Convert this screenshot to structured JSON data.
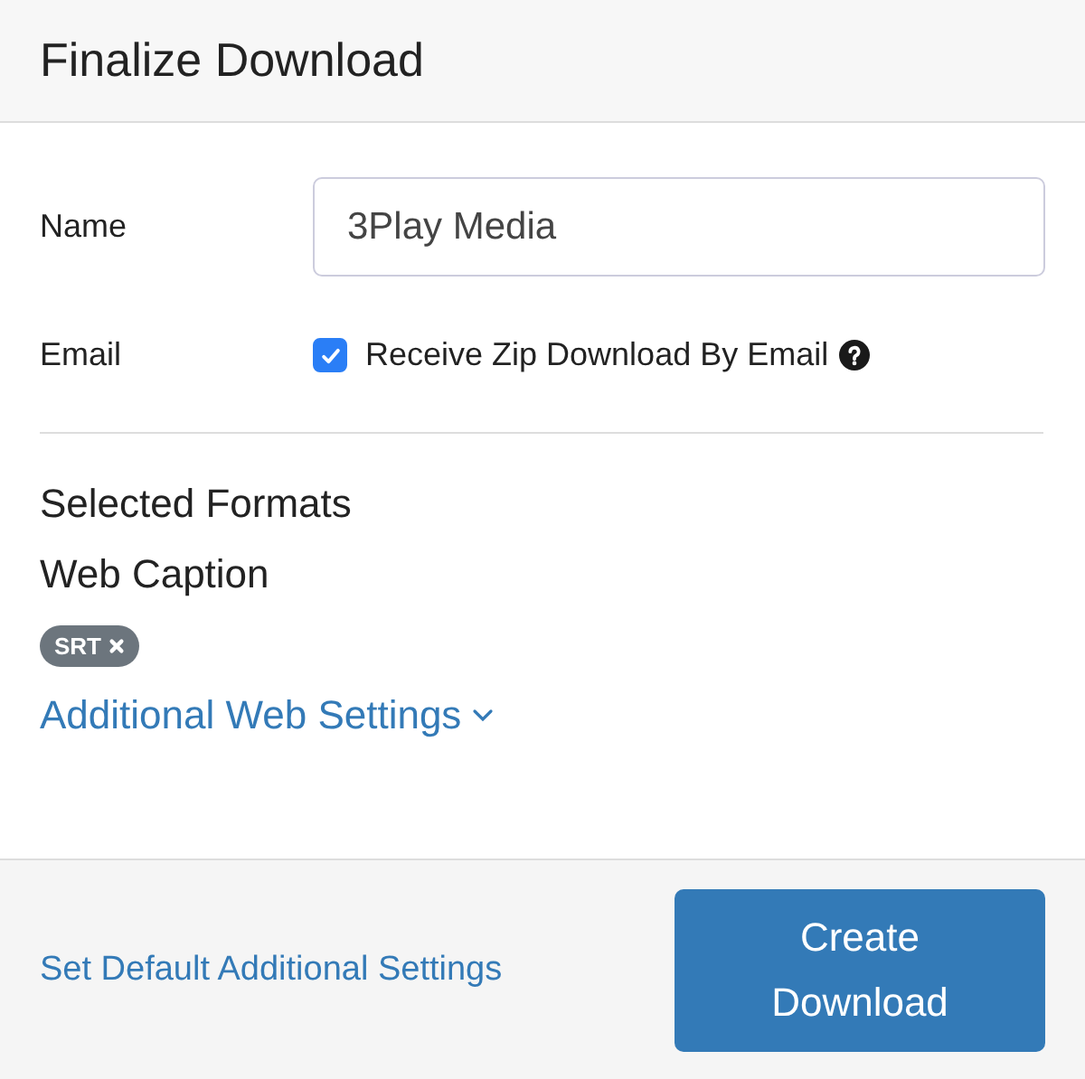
{
  "window": {
    "title": "Finalize Download"
  },
  "name_field": {
    "label": "Name",
    "value": "3Play Media"
  },
  "email_option": {
    "label": "Email",
    "checkbox_label": "Receive Zip Download By Email",
    "checked": true
  },
  "formats": {
    "heading": "Selected Formats",
    "group": "Web Caption",
    "tags": [
      {
        "label": "SRT"
      }
    ],
    "settings_link": "Additional Web Settings"
  },
  "footer": {
    "link": "Set Default Additional Settings",
    "button": "Create Download"
  }
}
